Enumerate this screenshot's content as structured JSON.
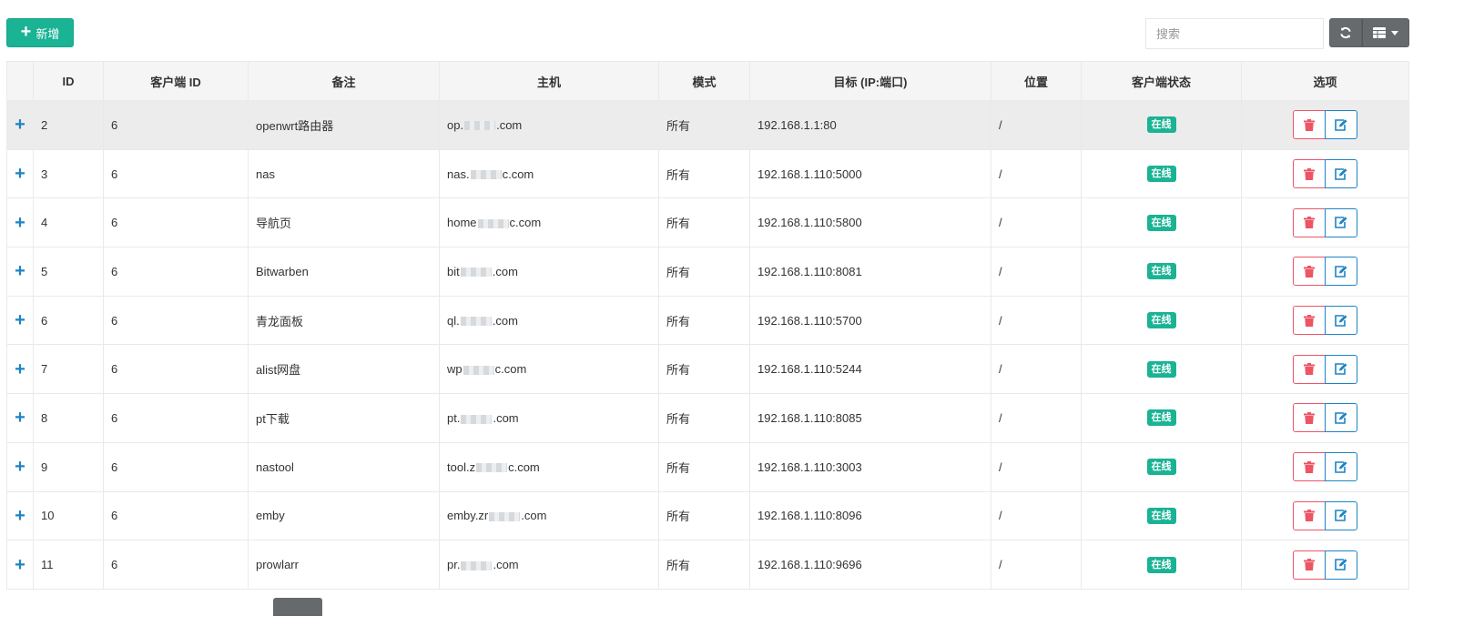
{
  "toolbar": {
    "add_label": "新增",
    "search_placeholder": "搜索"
  },
  "columns": [
    "",
    "ID",
    "客户端 ID",
    "备注",
    "主机",
    "模式",
    "目标 (IP:端口)",
    "位置",
    "客户端状态",
    "选项"
  ],
  "rows": [
    {
      "id": "2",
      "client_id": "6",
      "remark": "openwrt路由器",
      "host_pre": "op.",
      "host_post": ".com",
      "mode": "所有",
      "target": "192.168.1.1:80",
      "location": "/",
      "status": "在线"
    },
    {
      "id": "3",
      "client_id": "6",
      "remark": "nas",
      "host_pre": "nas.",
      "host_post": "c.com",
      "mode": "所有",
      "target": "192.168.1.110:5000",
      "location": "/",
      "status": "在线"
    },
    {
      "id": "4",
      "client_id": "6",
      "remark": "导航页",
      "host_pre": "home",
      "host_post": "c.com",
      "mode": "所有",
      "target": "192.168.1.110:5800",
      "location": "/",
      "status": "在线"
    },
    {
      "id": "5",
      "client_id": "6",
      "remark": "Bitwarben",
      "host_pre": "bit",
      "host_post": ".com",
      "mode": "所有",
      "target": "192.168.1.110:8081",
      "location": "/",
      "status": "在线"
    },
    {
      "id": "6",
      "client_id": "6",
      "remark": "青龙面板",
      "host_pre": "ql.",
      "host_post": ".com",
      "mode": "所有",
      "target": "192.168.1.110:5700",
      "location": "/",
      "status": "在线"
    },
    {
      "id": "7",
      "client_id": "6",
      "remark": "alist网盘",
      "host_pre": "wp",
      "host_post": "c.com",
      "mode": "所有",
      "target": "192.168.1.110:5244",
      "location": "/",
      "status": "在线"
    },
    {
      "id": "8",
      "client_id": "6",
      "remark": "pt下载",
      "host_pre": "pt.",
      "host_post": ".com",
      "mode": "所有",
      "target": "192.168.1.110:8085",
      "location": "/",
      "status": "在线"
    },
    {
      "id": "9",
      "client_id": "6",
      "remark": "nastool",
      "host_pre": "tool.z",
      "host_post": "c.com",
      "mode": "所有",
      "target": "192.168.1.110:3003",
      "location": "/",
      "status": "在线"
    },
    {
      "id": "10",
      "client_id": "6",
      "remark": "emby",
      "host_pre": "emby.zr",
      "host_post": ".com",
      "mode": "所有",
      "target": "192.168.1.110:8096",
      "location": "/",
      "status": "在线"
    },
    {
      "id": "11",
      "client_id": "6",
      "remark": "prowlarr",
      "host_pre": "pr.",
      "host_post": ".com",
      "mode": "所有",
      "target": "192.168.1.110:9696",
      "location": "/",
      "status": "在线"
    }
  ],
  "icons": {
    "expand": "plus-icon",
    "delete": "trash-icon",
    "edit": "edit-icon",
    "refresh": "refresh-icon",
    "columns": "columns-icon"
  },
  "colors": {
    "primary": "#1ab394",
    "danger": "#ed5565",
    "info": "#1c84c6",
    "tool": "#676a6c"
  }
}
